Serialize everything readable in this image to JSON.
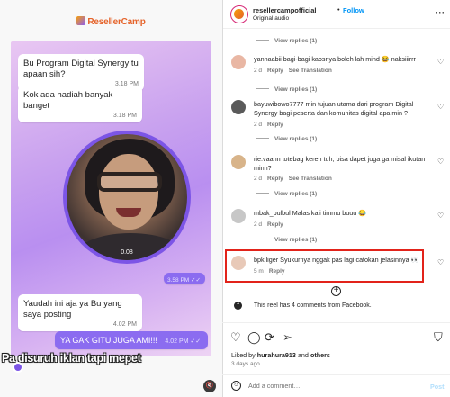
{
  "media": {
    "brand": "ResellerCamp",
    "messages": [
      {
        "text": "Bu Program Digital Synergy tu apaan sih?",
        "time": "3.18 PM"
      },
      {
        "text": "Kok ada hadiah banyak banget",
        "time": "3.18 PM"
      },
      {
        "text": "Yaudah ini aja ya Bu yang saya posting",
        "time": "4.02 PM"
      }
    ],
    "video_duration": "0.08",
    "video_sent_time": "3.58 PM ✓✓",
    "outgoing_message": {
      "text": "YA GAK GITU JUGA AMI!!!",
      "time": "4.02 PM ✓✓"
    },
    "caption": "Pa disuruh iklan tapi mepet",
    "mute_icon": "speaker-muted-icon"
  },
  "header": {
    "username": "resellercampofficial",
    "dot": "•",
    "follow_label": "Follow",
    "audio": "Original audio",
    "more_label": "···"
  },
  "view_replies_label": "View replies (1)",
  "comments": [
    {
      "text": "yannaabii bagi-bagi kaosnya boleh lah mind 😂 naksiiirrr",
      "age": "2 d",
      "reply": "Reply",
      "translate": "See Translation",
      "avatar_color": "#e9b7a4"
    },
    {
      "text": "bayuwibowo7777 min tujuan utama dari program Digital Synergy bagi peserta dan komunitas digital apa min ?",
      "age": "2 d",
      "reply": "Reply",
      "translate": "",
      "avatar_color": "#5a5a5a"
    },
    {
      "text": "rie.vaann totebag keren tuh, bisa dapet juga ga misal ikutan minn?",
      "age": "2 d",
      "reply": "Reply",
      "translate": "See Translation",
      "avatar_color": "#d8b48a"
    },
    {
      "text": "mbak_bulbul Malas kali timmu buuu 😂",
      "age": "2 d",
      "reply": "Reply",
      "translate": "",
      "avatar_color": "#c7c7c7"
    },
    {
      "text": "bpk.liger Syukurnya nggak pas lagi catokan jelasinnya 👀",
      "age": "5 m",
      "reply": "Reply",
      "translate": "",
      "avatar_color": "#e8c9b8"
    }
  ],
  "facebook_note": "This reel has 4 comments from Facebook.",
  "likes": {
    "prefix": "Liked by",
    "user": "hurahura913",
    "and": "and",
    "others": "others"
  },
  "posted": "3 days ago",
  "input": {
    "placeholder": "Add a comment…",
    "post_label": "Post"
  },
  "icons": [
    "heart-icon",
    "comment-icon",
    "repost-icon",
    "share-icon",
    "bookmark-icon"
  ]
}
